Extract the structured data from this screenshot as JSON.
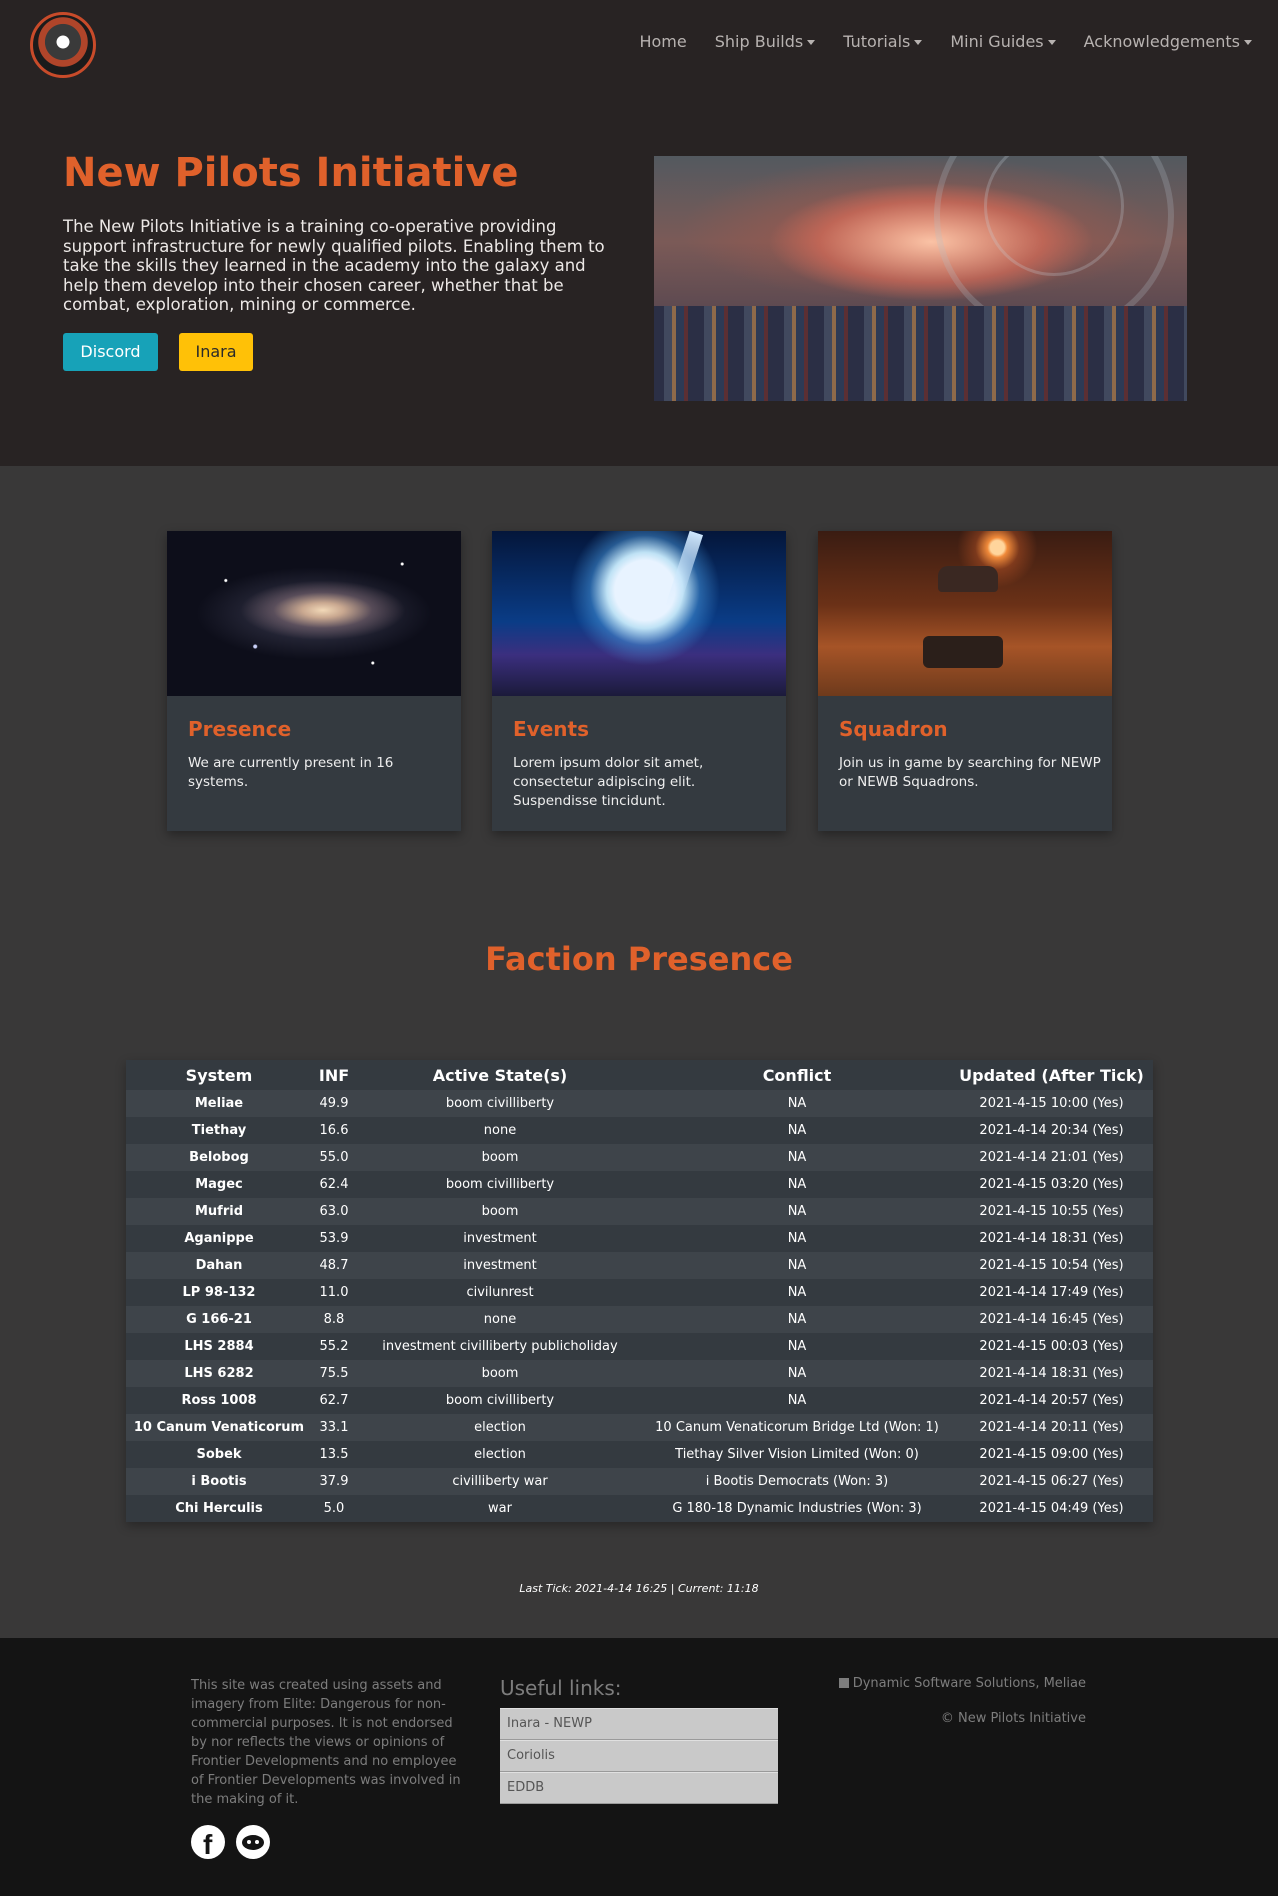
{
  "nav": {
    "items": [
      {
        "label": "Home",
        "dropdown": false
      },
      {
        "label": "Ship Builds",
        "dropdown": true
      },
      {
        "label": "Tutorials",
        "dropdown": true
      },
      {
        "label": "Mini Guides",
        "dropdown": true
      },
      {
        "label": "Acknowledgements",
        "dropdown": true
      }
    ]
  },
  "hero": {
    "title": "New Pilots Initiative",
    "text": "The New Pilots Initiative is a training co-operative providing support infrastructure for newly qualified pilots. Enabling them to take the skills they learned in the academy into the galaxy and help them develop into their chosen career, whether that be combat, exploration, mining or commerce.",
    "discord_label": "Discord",
    "inara_label": "Inara"
  },
  "cards": [
    {
      "title": "Presence",
      "text": "We are currently present in 16 systems."
    },
    {
      "title": "Events",
      "text": "Lorem ipsum dolor sit amet, consectetur adipiscing elit. Suspendisse tincidunt."
    },
    {
      "title": "Squadron",
      "text": "Join us in game by searching for NEWP or NEWB Squadrons."
    }
  ],
  "faction": {
    "title": "Faction Presence",
    "columns": [
      "System",
      "INF",
      "Active State(s)",
      "Conflict",
      "Updated (After Tick)"
    ],
    "rows": [
      [
        "Meliae",
        "49.9",
        "boom civilliberty",
        "NA",
        "2021-4-15 10:00 (Yes)"
      ],
      [
        "Tiethay",
        "16.6",
        "none",
        "NA",
        "2021-4-14 20:34 (Yes)"
      ],
      [
        "Belobog",
        "55.0",
        "boom",
        "NA",
        "2021-4-14 21:01 (Yes)"
      ],
      [
        "Magec",
        "62.4",
        "boom civilliberty",
        "NA",
        "2021-4-15 03:20 (Yes)"
      ],
      [
        "Mufrid",
        "63.0",
        "boom",
        "NA",
        "2021-4-15 10:55 (Yes)"
      ],
      [
        "Aganippe",
        "53.9",
        "investment",
        "NA",
        "2021-4-14 18:31 (Yes)"
      ],
      [
        "Dahan",
        "48.7",
        "investment",
        "NA",
        "2021-4-15 10:54 (Yes)"
      ],
      [
        "LP 98-132",
        "11.0",
        "civilunrest",
        "NA",
        "2021-4-14 17:49 (Yes)"
      ],
      [
        "G 166-21",
        "8.8",
        "none",
        "NA",
        "2021-4-14 16:45 (Yes)"
      ],
      [
        "LHS 2884",
        "55.2",
        "investment civilliberty publicholiday",
        "NA",
        "2021-4-15 00:03 (Yes)"
      ],
      [
        "LHS 6282",
        "75.5",
        "boom",
        "NA",
        "2021-4-14 18:31 (Yes)"
      ],
      [
        "Ross 1008",
        "62.7",
        "boom civilliberty",
        "NA",
        "2021-4-14 20:57 (Yes)"
      ],
      [
        "10 Canum Venaticorum",
        "33.1",
        "election",
        "10 Canum Venaticorum Bridge Ltd (Won: 1)",
        "2021-4-14 20:11 (Yes)"
      ],
      [
        "Sobek",
        "13.5",
        "election",
        "Tiethay Silver Vision Limited (Won: 0)",
        "2021-4-15 09:00 (Yes)"
      ],
      [
        "i Bootis",
        "37.9",
        "civilliberty war",
        "i Bootis Democrats (Won: 3)",
        "2021-4-15 06:27 (Yes)"
      ],
      [
        "Chi Herculis",
        "5.0",
        "war",
        "G 180-18 Dynamic Industries (Won: 3)",
        "2021-4-15 04:49 (Yes)"
      ]
    ],
    "tick_text": "Last Tick: 2021-4-14 16:25 | Current: 11:18"
  },
  "footer": {
    "disclaimer": "This site was created using assets and imagery from Elite: Dangerous for non-commercial purposes. It is not endorsed by nor reflects the views or opinions of Frontier Developments and no employee of Frontier Developments was involved in the making of it.",
    "links_title": "Useful links:",
    "links": [
      "Inara - NEWP",
      "Coriolis",
      "EDDB"
    ],
    "company": "Dynamic Software Solutions, Meliae",
    "copyright": "© New Pilots Initiative",
    "social_icons": [
      "facebook-icon",
      "reddit-icon"
    ]
  },
  "colors": {
    "accent": "#e0612b",
    "discord_button": "#17a2b8",
    "inara_button": "#ffc107",
    "navbar_bg": "#282323",
    "section_bg": "#393838",
    "card_bg": "#343a40",
    "footer_bg": "#141414"
  }
}
